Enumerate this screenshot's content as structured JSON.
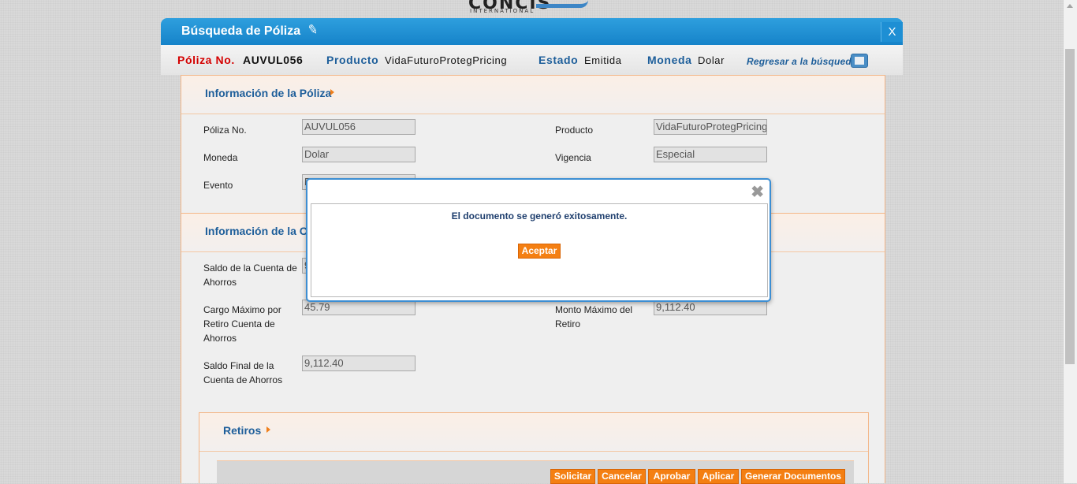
{
  "brand": {
    "logo_text": "CONCIS",
    "logo_sub": "INTERNATIONAL"
  },
  "window": {
    "title": "Búsqueda de Póliza",
    "close_label": "X"
  },
  "infobar": {
    "poliza_label": "Póliza No.",
    "poliza_value": "AUVUL056",
    "producto_label": "Producto",
    "producto_value": "VidaFuturoProtegPricing",
    "estado_label": "Estado",
    "estado_value": "Emitida",
    "moneda_label": "Moneda",
    "moneda_value": "Dolar",
    "back_link": "Regresar a la búsqueda"
  },
  "policy_info": {
    "title": "Información de la Póliza",
    "poliza_label": "Póliza No.",
    "poliza_value": "AUVUL056",
    "producto_label": "Producto",
    "producto_value": "VidaFuturoProtegPricing",
    "moneda_label": "Moneda",
    "moneda_value": "Dolar",
    "vigencia_label": "Vigencia",
    "vigencia_value": "Especial",
    "evento_label": "Evento",
    "evento_value": "E"
  },
  "account_info": {
    "title": "Información de la Cu",
    "saldo_label": "Saldo de la Cuenta de Ahorros",
    "saldo_value": "9",
    "cargo_label": "Cargo Máximo por Retiro Cuenta de Ahorros",
    "cargo_value": "45.79",
    "monto_label": "Monto Máximo del Retiro",
    "monto_value": "9,112.40",
    "saldo_final_label": "Saldo Final de la Cuenta de Ahorros",
    "saldo_final_value": "9,112.40"
  },
  "retiros": {
    "title": "Retiros",
    "buttons": {
      "solicitar": "Solicitar",
      "cancelar": "Cancelar",
      "aprobar": "Aprobar",
      "aplicar": "Aplicar",
      "generar": "Generar Documentos"
    }
  },
  "dialog": {
    "message": "El documento se generó exitosamente.",
    "ok_label": "Aceptar",
    "close_glyph": "✖"
  },
  "icons": {
    "title_pen": "pen-icon",
    "edit": "edit-icon",
    "section_arrow": "arrow-right-icon"
  },
  "colors": {
    "title_blue": "#1683c9",
    "label_blue": "#1d5e9a",
    "label_red": "#d40000",
    "button_orange": "#f47f12"
  }
}
